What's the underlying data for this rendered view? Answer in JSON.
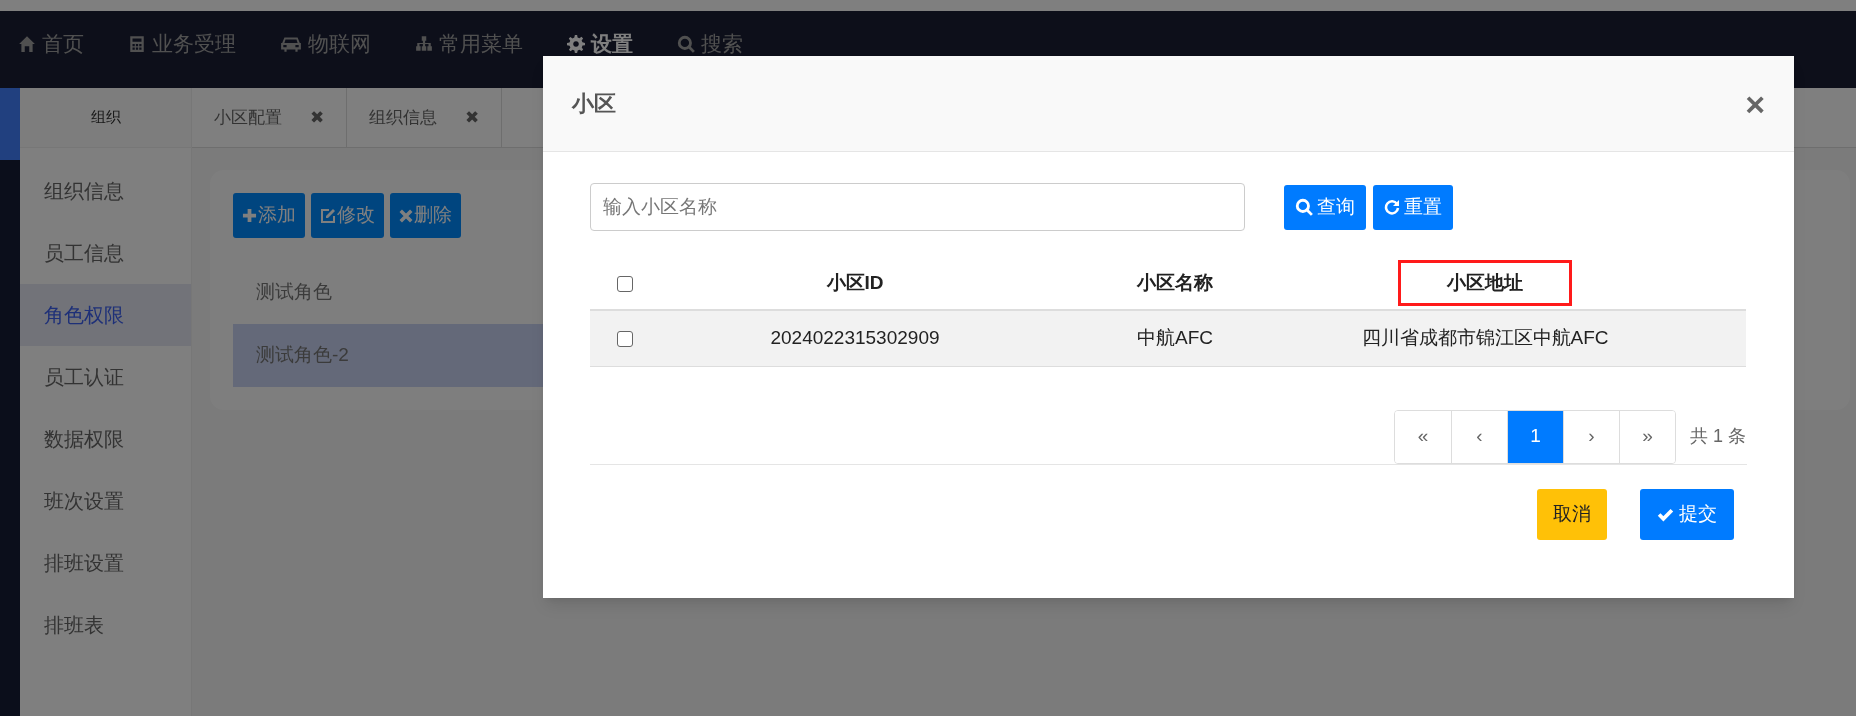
{
  "nav": [
    {
      "label": "首页",
      "kind": "home",
      "selected": false
    },
    {
      "label": "业务受理",
      "kind": "calculator",
      "selected": false
    },
    {
      "label": "物联网",
      "kind": "car",
      "selected": false
    },
    {
      "label": "常用菜单",
      "kind": "sitemap",
      "selected": false
    },
    {
      "label": "设置",
      "kind": "gear",
      "selected": true
    },
    {
      "label": "搜索",
      "kind": "search",
      "selected": false
    }
  ],
  "sidebar": {
    "header": "组织",
    "items": [
      {
        "label": "组织信息",
        "selected": false
      },
      {
        "label": "员工信息",
        "selected": false
      },
      {
        "label": "角色权限",
        "selected": true
      },
      {
        "label": "员工认证",
        "selected": false
      },
      {
        "label": "数据权限",
        "selected": false
      },
      {
        "label": "班次设置",
        "selected": false
      },
      {
        "label": "排班设置",
        "selected": false
      },
      {
        "label": "排班表",
        "selected": false
      }
    ]
  },
  "tabs": [
    {
      "label": "小区配置",
      "close": "✖"
    },
    {
      "label": "组织信息",
      "close": "✖"
    }
  ],
  "toolbar": [
    {
      "label": "添加",
      "kind": "add"
    },
    {
      "label": "修改",
      "kind": "edit"
    },
    {
      "label": "删除",
      "kind": "delete"
    }
  ],
  "roles": [
    {
      "label": "测试角色",
      "selected": false
    },
    {
      "label": "测试角色-2",
      "selected": true
    }
  ],
  "modal": {
    "title": "小区",
    "close": "×",
    "search": {
      "placeholder": "输入小区名称"
    },
    "search_buttons": [
      {
        "label": "查询",
        "kind": "search"
      },
      {
        "label": "重置",
        "kind": "reset"
      }
    ],
    "table": {
      "header_checked": false,
      "columns": [
        {
          "label": "小区ID",
          "highlighted": false
        },
        {
          "label": "小区名称",
          "highlighted": false
        },
        {
          "label": "小区地址",
          "highlighted": true
        }
      ],
      "rows": [
        {
          "checked": false,
          "cells": [
            "2024022315302909",
            "中航AFC",
            "四川省成都市锦江区中航AFC"
          ]
        }
      ]
    },
    "pagination": {
      "pages": [
        {
          "label": "«",
          "selected": false
        },
        {
          "label": "‹",
          "selected": false
        },
        {
          "label": "1",
          "selected": true
        },
        {
          "label": "›",
          "selected": false
        },
        {
          "label": "»",
          "selected": false
        }
      ],
      "total": "共 1 条"
    },
    "footer_buttons": [
      {
        "label": "取消",
        "kind": "cancel"
      },
      {
        "label": "提交",
        "kind": "submit"
      }
    ]
  }
}
